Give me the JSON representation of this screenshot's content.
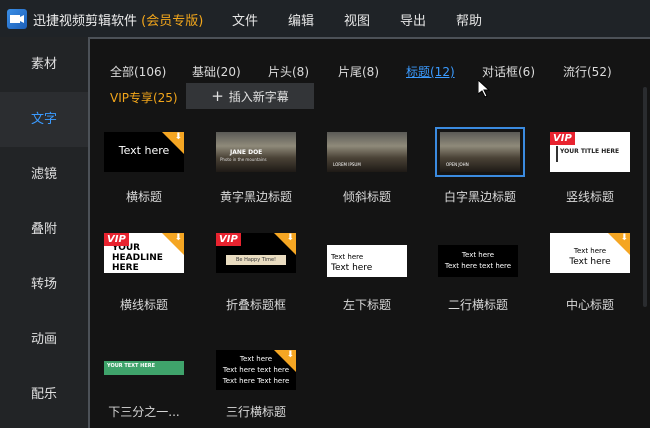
{
  "app": {
    "title": "迅捷视频剪辑软件",
    "edition": "(会员专版)"
  },
  "menu": [
    "文件",
    "编辑",
    "视图",
    "导出",
    "帮助"
  ],
  "sidebar": [
    "素材",
    "文字",
    "滤镜",
    "叠附",
    "转场",
    "动画",
    "配乐"
  ],
  "tabs": [
    "全部(106)",
    "基础(20)",
    "片头(8)",
    "片尾(8)",
    "标题(12)",
    "对话框(6)",
    "流行(52)",
    "VIP专享(25)"
  ],
  "insert_button": {
    "icon": "+",
    "label": "插入新字幕"
  },
  "badges": {
    "vip": "VIP",
    "download": "⬇"
  },
  "thumbs": {
    "t1": "Text here",
    "t2a": "JANE DOE",
    "t2b": "Photo in the mountains",
    "t3": "LOREM IPSUM",
    "t4": "OPEN JOHN",
    "t5": "YOUR TITLE HERE",
    "t6": "YOUR HEADLINE HERE",
    "t7": "Be Happy Time!",
    "t8a": "Text here",
    "t8b": "Text here",
    "t9a": "Text here",
    "t9b": "Text here text here",
    "t10a": "Text here",
    "t10b": "Text here",
    "t11": "YOUR TEXT HERE",
    "t12a": "Text here",
    "t12b": "Text here text here",
    "t12c": "Text here Text here"
  },
  "captions": [
    "横标题",
    "黄字黑边标题",
    "倾斜标题",
    "白字黑边标题",
    "竖线标题",
    "横线标题",
    "折叠标题框",
    "左下标题",
    "二行横标题",
    "中心标题",
    "下三分之一...",
    "三行横标题"
  ],
  "colors": {
    "accent": "#3b9bff",
    "vip": "#f2a61b",
    "badge_red": "#e8232f"
  }
}
